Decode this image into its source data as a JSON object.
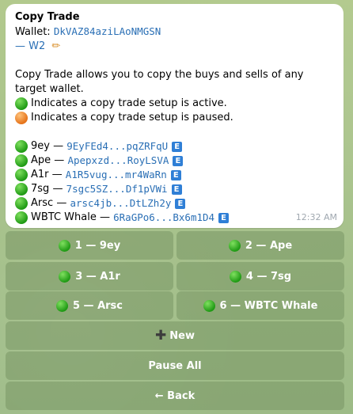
{
  "message": {
    "title": "Copy Trade",
    "wallet_label": "Wallet:",
    "wallet_address": "DkVAZ84aziLAoNMGSN",
    "wallet_prefix": "—",
    "wallet_name": "W2",
    "description": "Copy Trade allows you to copy the buys and sells of any target wallet.",
    "legend": [
      {
        "status": "active",
        "text": "Indicates a copy trade setup is active."
      },
      {
        "status": "paused",
        "text": "Indicates a copy trade setup is paused."
      }
    ],
    "trades": [
      {
        "name": "9ey",
        "sep": "—",
        "address": "9EyFEd4...pqZRFqU",
        "badge": "E"
      },
      {
        "name": "Ape",
        "sep": "—",
        "address": "Apepxzd...RoyLSVA",
        "badge": "E"
      },
      {
        "name": "A1r",
        "sep": "—",
        "address": "A1R5vug...mr4WaRn",
        "badge": "E"
      },
      {
        "name": "7sg",
        "sep": "—",
        "address": "7sgc5SZ...Df1pVWi",
        "badge": "E"
      },
      {
        "name": "Arsc",
        "sep": "—",
        "address": "arsc4jb...DtLZh2y",
        "badge": "E"
      },
      {
        "name": "WBTC Whale",
        "sep": "—",
        "address": "6RaGPo6...Bx6m1D4",
        "badge": "E"
      }
    ],
    "time": "12:32 AM"
  },
  "keyboard": {
    "trade_buttons": [
      {
        "label": "1 — 9ey"
      },
      {
        "label": "2 — Ape"
      },
      {
        "label": "3 — A1r"
      },
      {
        "label": "4 — 7sg"
      },
      {
        "label": "5 — Arsc"
      },
      {
        "label": "6 — WBTC Whale"
      }
    ],
    "new_label": "New",
    "pause_all_label": "Pause All",
    "back_label": "← Back"
  },
  "colors": {
    "link": "#2a6fb5",
    "active": "#1f9a14",
    "paused": "#e5731a",
    "button_bg": "#7f9a68"
  }
}
